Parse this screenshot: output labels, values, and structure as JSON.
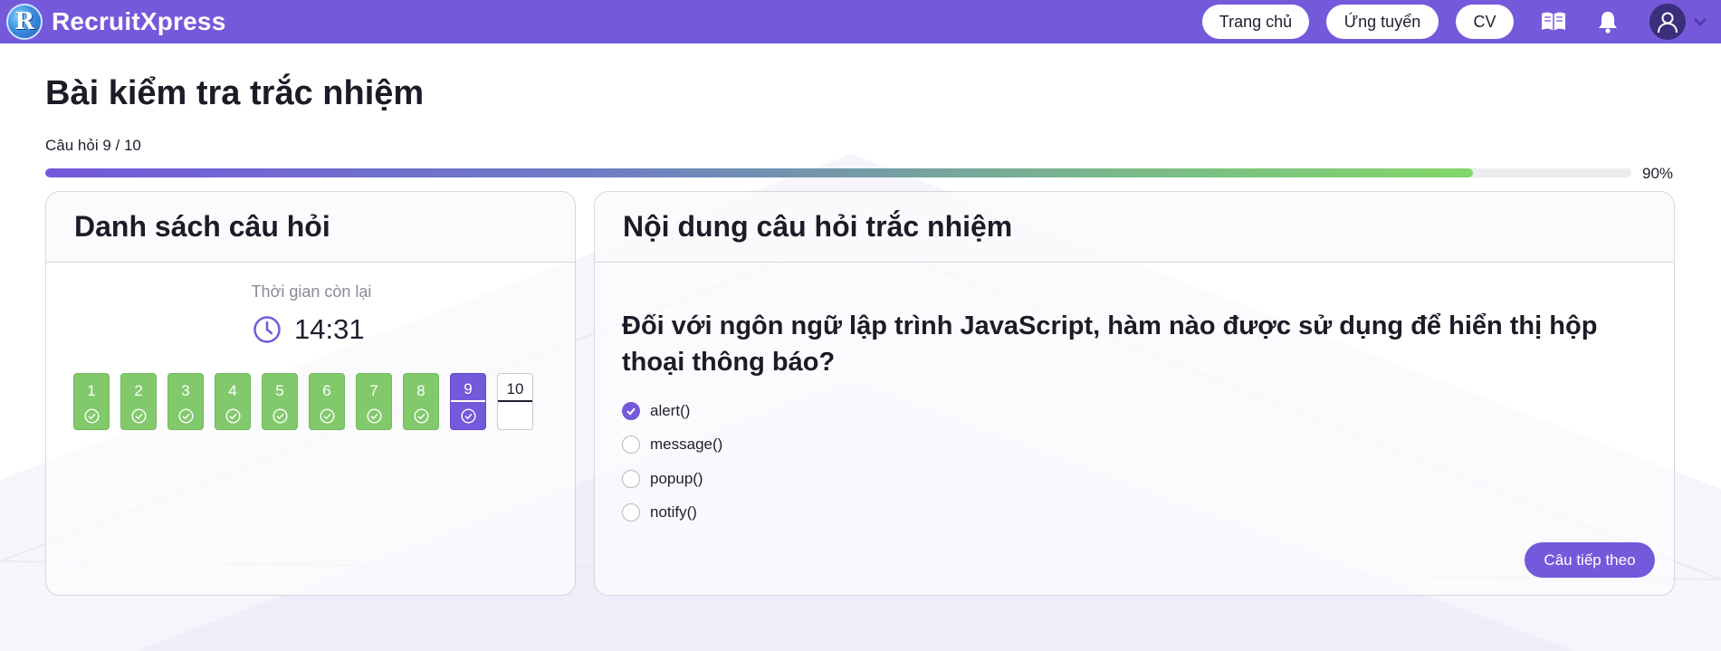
{
  "brand": {
    "name": "RecruitXpress",
    "logo_letter": "R"
  },
  "nav": {
    "home": "Trang chủ",
    "apply": "Ứng tuyển",
    "cv": "CV"
  },
  "header_icons": [
    "book-open-icon",
    "bell-icon",
    "user-icon",
    "chevron-down-icon"
  ],
  "page": {
    "title": "Bài kiểm tra trắc nhiệm",
    "counter": "Câu hỏi 9 / 10",
    "progress_fraction": 0.9,
    "progress_label": "90%"
  },
  "left_panel": {
    "title": "Danh sách câu hỏi",
    "timer_label": "Thời gian còn lại",
    "timer_value": "14:31",
    "questions": [
      {
        "number": "1",
        "status": "done"
      },
      {
        "number": "2",
        "status": "done"
      },
      {
        "number": "3",
        "status": "done"
      },
      {
        "number": "4",
        "status": "done"
      },
      {
        "number": "5",
        "status": "done"
      },
      {
        "number": "6",
        "status": "done"
      },
      {
        "number": "7",
        "status": "done"
      },
      {
        "number": "8",
        "status": "done"
      },
      {
        "number": "9",
        "status": "current"
      },
      {
        "number": "10",
        "status": "todo"
      }
    ]
  },
  "right_panel": {
    "title": "Nội dung câu hỏi trắc nhiệm",
    "question": "Đối với ngôn ngữ lập trình JavaScript, hàm nào được sử dụng để hiển thị hộp thoại thông báo?",
    "options": [
      {
        "label": "alert()",
        "selected": true
      },
      {
        "label": "message()",
        "selected": false
      },
      {
        "label": "popup()",
        "selected": false
      },
      {
        "label": "notify()",
        "selected": false
      }
    ],
    "next_button": "Câu tiếp theo"
  },
  "colors": {
    "primary": "#7459db",
    "done": "#82c96c",
    "progress_end": "#84d66a"
  }
}
